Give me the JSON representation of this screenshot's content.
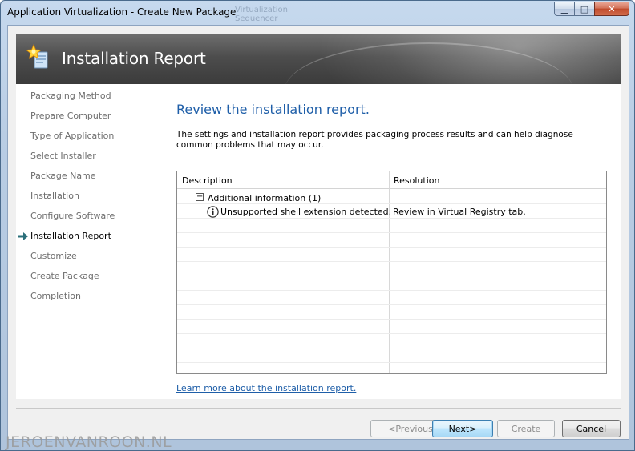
{
  "window": {
    "title": "Application Virtualization - Create New Package",
    "ghost_text": "Virtualization Sequencer",
    "controls": {
      "minimize": "▁",
      "maximize": "□",
      "close": "✕"
    }
  },
  "banner": {
    "title": "Installation Report",
    "icon": "wizard-star-icon"
  },
  "nav": {
    "items": [
      {
        "label": "Packaging Method",
        "current": false
      },
      {
        "label": "Prepare Computer",
        "current": false
      },
      {
        "label": "Type of Application",
        "current": false
      },
      {
        "label": "Select Installer",
        "current": false
      },
      {
        "label": "Package Name",
        "current": false
      },
      {
        "label": "Installation",
        "current": false
      },
      {
        "label": "Configure Software",
        "current": false
      },
      {
        "label": "Installation Report",
        "current": true
      },
      {
        "label": "Customize",
        "current": false
      },
      {
        "label": "Create Package",
        "current": false
      },
      {
        "label": "Completion",
        "current": false
      }
    ],
    "current_indicator": "arrow-right-icon"
  },
  "main": {
    "heading": "Review the installation report.",
    "description": "The settings and installation report provides packaging process results and can help diagnose common problems that may occur.",
    "grid": {
      "columns": [
        "Description",
        "Resolution"
      ],
      "group": {
        "expander": "−",
        "label": "Additional information (1)"
      },
      "rows": [
        {
          "icon": "info-icon",
          "description": "Unsupported shell extension detected.",
          "resolution": "Review in Virtual Registry tab."
        }
      ]
    },
    "learn_more_link": "Learn more about the installation report."
  },
  "buttons": {
    "previous": "<Previous",
    "next": "Next>",
    "create": "Create",
    "cancel": "Cancel"
  },
  "watermark": "JEROENVANROON.NL",
  "colors": {
    "heading_blue": "#1e5ea8",
    "banner_gray": "#4d4d4d",
    "nav_inactive": "#6d6d6d",
    "arrow_teal": "#2a6f7a"
  }
}
